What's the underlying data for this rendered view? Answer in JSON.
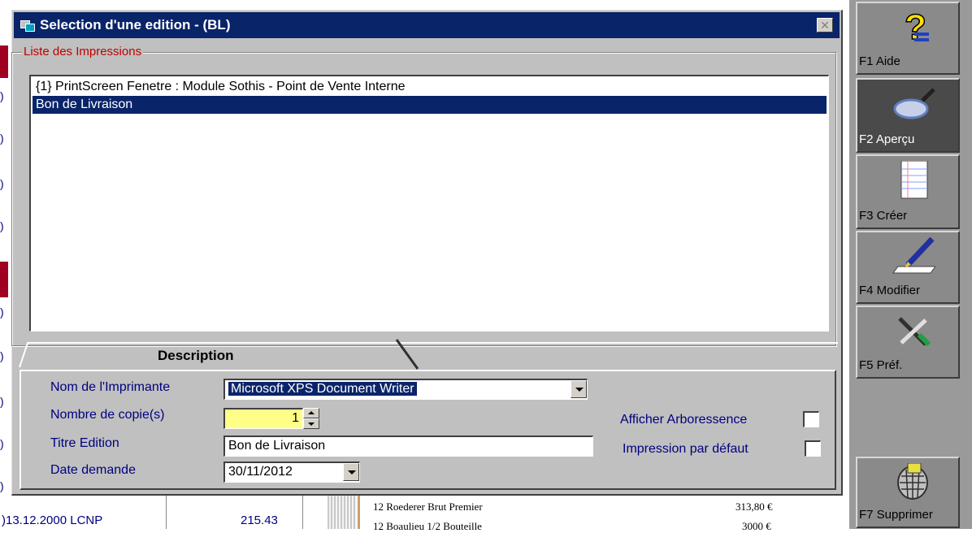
{
  "dialog": {
    "title": "Selection d'une edition - (BL)",
    "close_label": "✕",
    "list_group_label": "Liste des Impressions",
    "list_items": [
      {
        "label": "{1} PrintScreen Fenetre : Module Sothis - Point de Vente Interne",
        "selected": false
      },
      {
        "label": "Bon de Livraison",
        "selected": true
      }
    ],
    "tab_label": "Description",
    "form": {
      "printer_label": "Nom de l'Imprimante",
      "printer_value": "Microsoft XPS Document Writer",
      "copies_label": "Nombre de copie(s)",
      "copies_value": "1",
      "title_label": "Titre Edition",
      "title_value": "Bon de Livraison",
      "date_label": "Date  demande",
      "date_value": "30/11/2012",
      "tree_label": "Afficher Arboressence",
      "tree_checked": false,
      "default_label": "Impression par défaut",
      "default_checked": false
    }
  },
  "toolbar": {
    "buttons": [
      {
        "label": "F1 Aide",
        "icon": "help-icon"
      },
      {
        "label": "F2 Aperçu",
        "icon": "magnifier-icon"
      },
      {
        "label": "F3 Créer",
        "icon": "new-document-icon"
      },
      {
        "label": "F4 Modifier",
        "icon": "pen-icon"
      },
      {
        "label": "F5 Préf.",
        "icon": "tools-icon"
      },
      {
        "label": "F7 Supprimer",
        "icon": "trash-icon"
      }
    ]
  },
  "background": {
    "row_date": ")13.12.2000  LCNP",
    "row_amount": "215.43",
    "receipt_line1": "12  Roederer Brut Premier",
    "receipt_line1_price": "313,80 €",
    "receipt_line2": "12  Boaulieu 1/2 Bouteille",
    "receipt_line2_price": "3000 €"
  },
  "colors": {
    "titlebar": "#0a246a",
    "selection": "#0a246a",
    "group_label": "#c00000",
    "form_label": "#000080",
    "copies_field": "#ffff88"
  }
}
